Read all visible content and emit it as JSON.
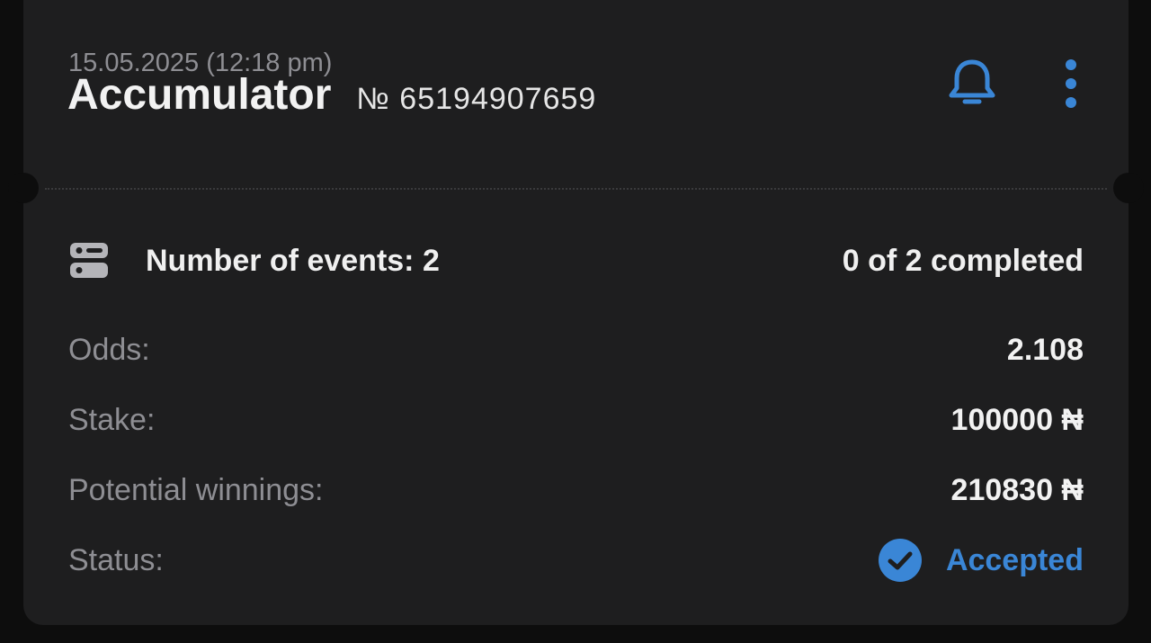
{
  "bet": {
    "date": "15.05.2025 (12:18 pm)",
    "type": "Accumulator",
    "number": "№ 65194907659"
  },
  "icons": {
    "bell": "bell-icon",
    "more": "more-vertical-icon",
    "events": "list-icon",
    "status": "check-circle-icon"
  },
  "events": {
    "label": "Number of events: 2",
    "completed": "0 of 2 completed"
  },
  "details": {
    "odds_label": "Odds:",
    "odds_value": "2.108",
    "stake_label": "Stake:",
    "stake_value": "100000 ₦",
    "winnings_label": "Potential winnings:",
    "winnings_value": "210830 ₦",
    "status_label": "Status:",
    "status_value": "Accepted"
  },
  "colors": {
    "accent": "#3a86d6",
    "card": "#1e1e1f",
    "background": "#0d0d0d"
  }
}
